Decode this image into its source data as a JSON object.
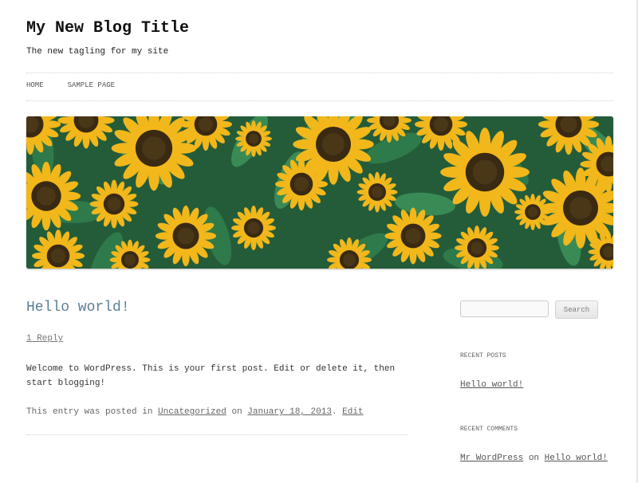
{
  "site": {
    "title": "My New Blog Title",
    "tagline": "The new tagling for my site"
  },
  "nav": {
    "items": [
      {
        "label": "HOME"
      },
      {
        "label": "SAMPLE PAGE"
      }
    ]
  },
  "banner": {
    "description_icon": "sunflower-field-image",
    "colors": {
      "petal": "#f2b71b",
      "center": "#3a2a12",
      "leaf": "#2f7a4a"
    }
  },
  "post": {
    "title": "Hello world!",
    "reply_link": "1 Reply",
    "body": "Welcome to WordPress. This is your first post. Edit or delete it, then start blogging!",
    "meta": {
      "prefix": "This entry was posted in",
      "category": "Uncategorized",
      "on": "on",
      "date": "January 18, 2013",
      "separator": ".",
      "edit": "Edit"
    }
  },
  "sidebar": {
    "search": {
      "placeholder": "",
      "value": "",
      "button_label": "Search"
    },
    "recent_posts": {
      "heading": "RECENT POSTS",
      "items": [
        {
          "label": "Hello world!"
        }
      ]
    },
    "recent_comments": {
      "heading": "RECENT COMMENTS",
      "items": [
        {
          "author": "Mr WordPress",
          "on": "on",
          "post": "Hello world!"
        }
      ]
    }
  },
  "colors": {
    "link_title": "#5b7f95",
    "text": "#333333"
  }
}
